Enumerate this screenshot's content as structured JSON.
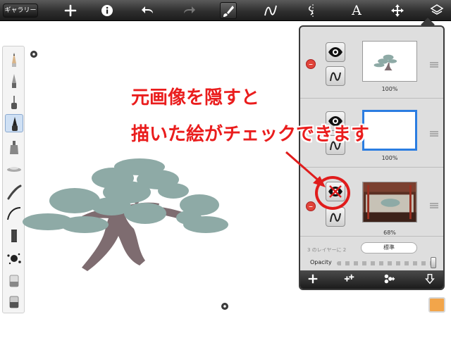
{
  "toolbar": {
    "gallery_label": "ギャラリー",
    "icons": [
      "plus-icon",
      "info-icon",
      "undo-icon",
      "redo-icon",
      "brush-icon",
      "stroke-icon",
      "symmetry-icon",
      "text-icon",
      "move-icon",
      "layers-icon"
    ],
    "text_tool_glyph": "A"
  },
  "brushes": [
    "pencil",
    "fine-pen",
    "marker",
    "ink-pen",
    "airbrush",
    "flat-brush",
    "feather-brush",
    "curve-stroke",
    "bristle-brush",
    "splatter",
    "eraser",
    "smudge"
  ],
  "layers": {
    "rows": [
      {
        "opacity": "100%",
        "thumbnail": "tree-sketch",
        "selected": false,
        "visible": true
      },
      {
        "opacity": "100%",
        "thumbnail": "blank",
        "selected": true,
        "visible": true
      },
      {
        "opacity": "68%",
        "thumbnail": "photo",
        "selected": false,
        "visible": false
      }
    ],
    "count_text": "3 のレイヤーに 2",
    "blend_mode": "標準",
    "opacity_label": "Opacity",
    "opacity_value": 0.98,
    "footer_icons": [
      "add-layer-icon",
      "duplicate-layer-icon",
      "merge-layer-icon",
      "export-layer-icon"
    ]
  },
  "annotation": {
    "line1": "元画像を隠すと",
    "line2": "描いた絵がチェックできます",
    "color": "#ea1d1d"
  },
  "colors": {
    "foliage": "#8eaaa6",
    "trunk": "#7e6c70",
    "current_color": "#f2a54a",
    "selection": "#2b7de1"
  }
}
